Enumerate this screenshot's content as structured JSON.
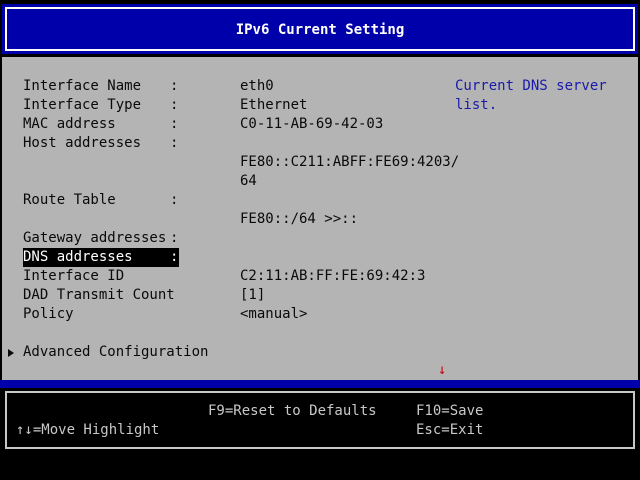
{
  "title": "IPv6 Current Setting",
  "fields": [
    {
      "label": "Interface Name",
      "colon": ":",
      "value": "eth0"
    },
    {
      "label": "Interface Type",
      "colon": ":",
      "value": "Ethernet"
    },
    {
      "label": "MAC address",
      "colon": ":",
      "value": "C0-11-AB-69-42-03"
    },
    {
      "label": "Host addresses",
      "colon": ":",
      "value": ""
    },
    {
      "label": "",
      "colon": "",
      "value": "FE80::C211:ABFF:FE69:4203/"
    },
    {
      "label": "",
      "colon": "",
      "value": "64"
    },
    {
      "label": "Route Table",
      "colon": ":",
      "value": ""
    },
    {
      "label": "",
      "colon": "",
      "value": "FE80::/64 >>::"
    },
    {
      "label": "Gateway addresses",
      "colon": ":",
      "value": ""
    },
    {
      "label": "DNS addresses",
      "colon": ":",
      "value": ""
    },
    {
      "label": "Interface ID",
      "colon": "",
      "value": "C2:11:AB:FF:FE:69:42:3"
    },
    {
      "label": "DAD Transmit Count",
      "colon": "",
      "value": "[1]"
    },
    {
      "label": "Policy",
      "colon": "",
      "value": "<manual>"
    }
  ],
  "help": {
    "line1": "Current DNS server",
    "line2": "list."
  },
  "advanced": {
    "label": "Advanced Configuration"
  },
  "scroll_arrow": "↓",
  "footer": {
    "reset": "F9=Reset to Defaults",
    "save": "F10=Save",
    "move": "↑↓=Move Highlight",
    "exit": "Esc=Exit"
  },
  "colors": {
    "title_bg": "#0000aa",
    "body_bg": "#b4b4b4",
    "help_text": "#1a1aaa",
    "highlight_bg": "#000000",
    "arrow": "#cc0000"
  }
}
